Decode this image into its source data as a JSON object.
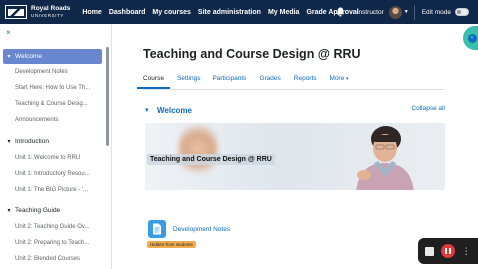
{
  "navbar": {
    "logo_line1": "Royal Roads",
    "logo_line2": "UNIVERSITY",
    "links": [
      "Home",
      "Dashboard",
      "My courses",
      "Site administration",
      "My Media",
      "Grade Approval"
    ],
    "user_role": "Instructor",
    "edit_mode_label": "Edit mode"
  },
  "drawer": {
    "close_glyph": "×",
    "sections": [
      {
        "title": "Welcome",
        "items": [
          "Development Notes",
          "Start Here: How to Use Th...",
          "Teaching & Course Desig...",
          "Announcements"
        ]
      },
      {
        "title": "Introduction",
        "items": [
          "Unit 1: Welcome to RRU",
          "Unit 1: Introductory Resou...",
          "Unit 1: The BIG Picture - '..."
        ]
      },
      {
        "title": "Teaching Guide",
        "items": [
          "Unit 2: Teaching Guide Ov...",
          "Unit 2: Preparing to Teach...",
          "Unit 2: Blended Courses"
        ]
      }
    ]
  },
  "main": {
    "course_title": "Teaching and Course Design @ RRU",
    "tabs": [
      "Course",
      "Settings",
      "Participants",
      "Grades",
      "Reports",
      "More"
    ],
    "section_title": "Welcome",
    "collapse_all": "Collapse all",
    "banner_text": "Teaching and Course Design @ RRU",
    "activity_name": "Development Notes",
    "hidden_badge": "Hidden from students"
  },
  "colors": {
    "navbar_bg": "#0f2849",
    "link_blue": "#0f6cbf",
    "drawer_active": "#6987cf",
    "badge_warning": "#f0ad4e",
    "record_red": "#e03a3a",
    "side_tab_teal": "#3bbfad"
  },
  "icons": {
    "bell": "bell-icon",
    "close": "close-icon",
    "chevron": "chevron-down-icon",
    "activity": "page-icon",
    "stop": "stop-icon",
    "pause": "pause-icon",
    "more": "more-icon"
  }
}
